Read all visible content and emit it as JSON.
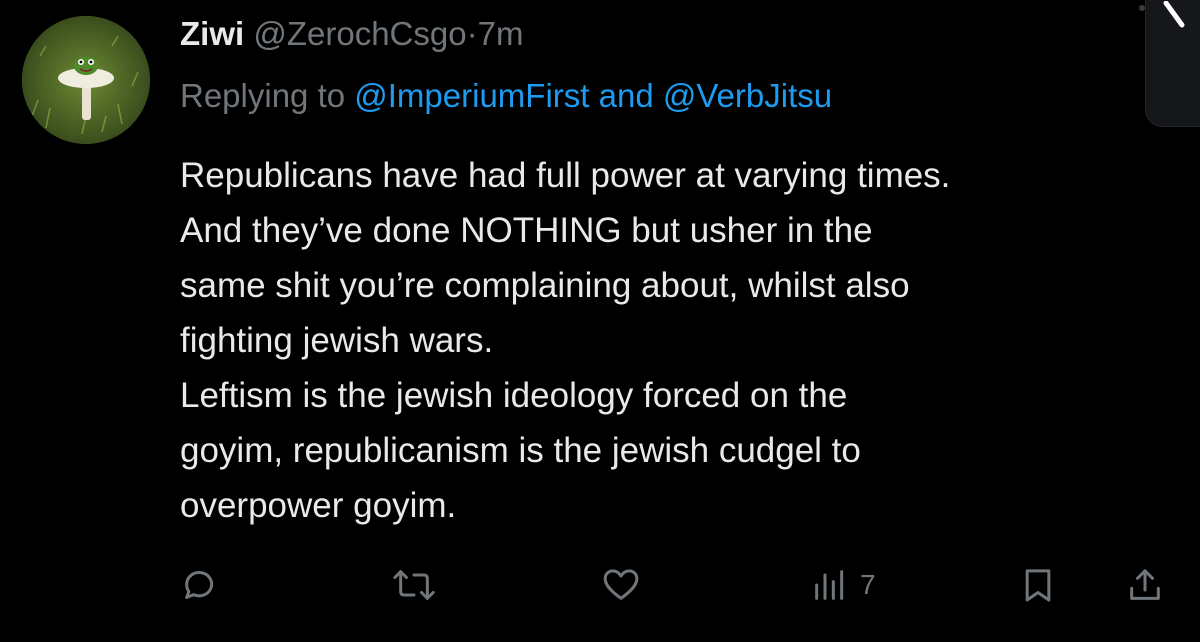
{
  "tweet": {
    "author": {
      "display_name": "Ziwi",
      "handle": "@ZerochCsgo",
      "separator": "·",
      "time": "7m"
    },
    "reply": {
      "prefix": "Replying to ",
      "mention1": "@ImperiumFirst",
      "conjunction": " and ",
      "mention2": "@VerbJitsu"
    },
    "lines": [
      "Republicans have had full power at varying times.",
      "And they’ve done NOTHING but usher in the",
      "same shit you’re complaining about, whilst also",
      "fighting jewish wars.",
      "Leftism is the jewish ideology forced on the",
      "goyim, republicanism is the jewish cudgel to",
      "overpower goyim."
    ]
  },
  "actions": {
    "reply_icon": "reply-bubble-icon",
    "retweet_icon": "retweet-icon",
    "like_icon": "heart-icon",
    "views_icon": "views-bar-chart-icon",
    "views_count": "7",
    "bookmark_icon": "bookmark-icon",
    "share_icon": "share-icon"
  },
  "colors": {
    "background": "#000000",
    "text": "#e7e9ea",
    "muted": "#71767b",
    "link": "#1d9bf0"
  }
}
